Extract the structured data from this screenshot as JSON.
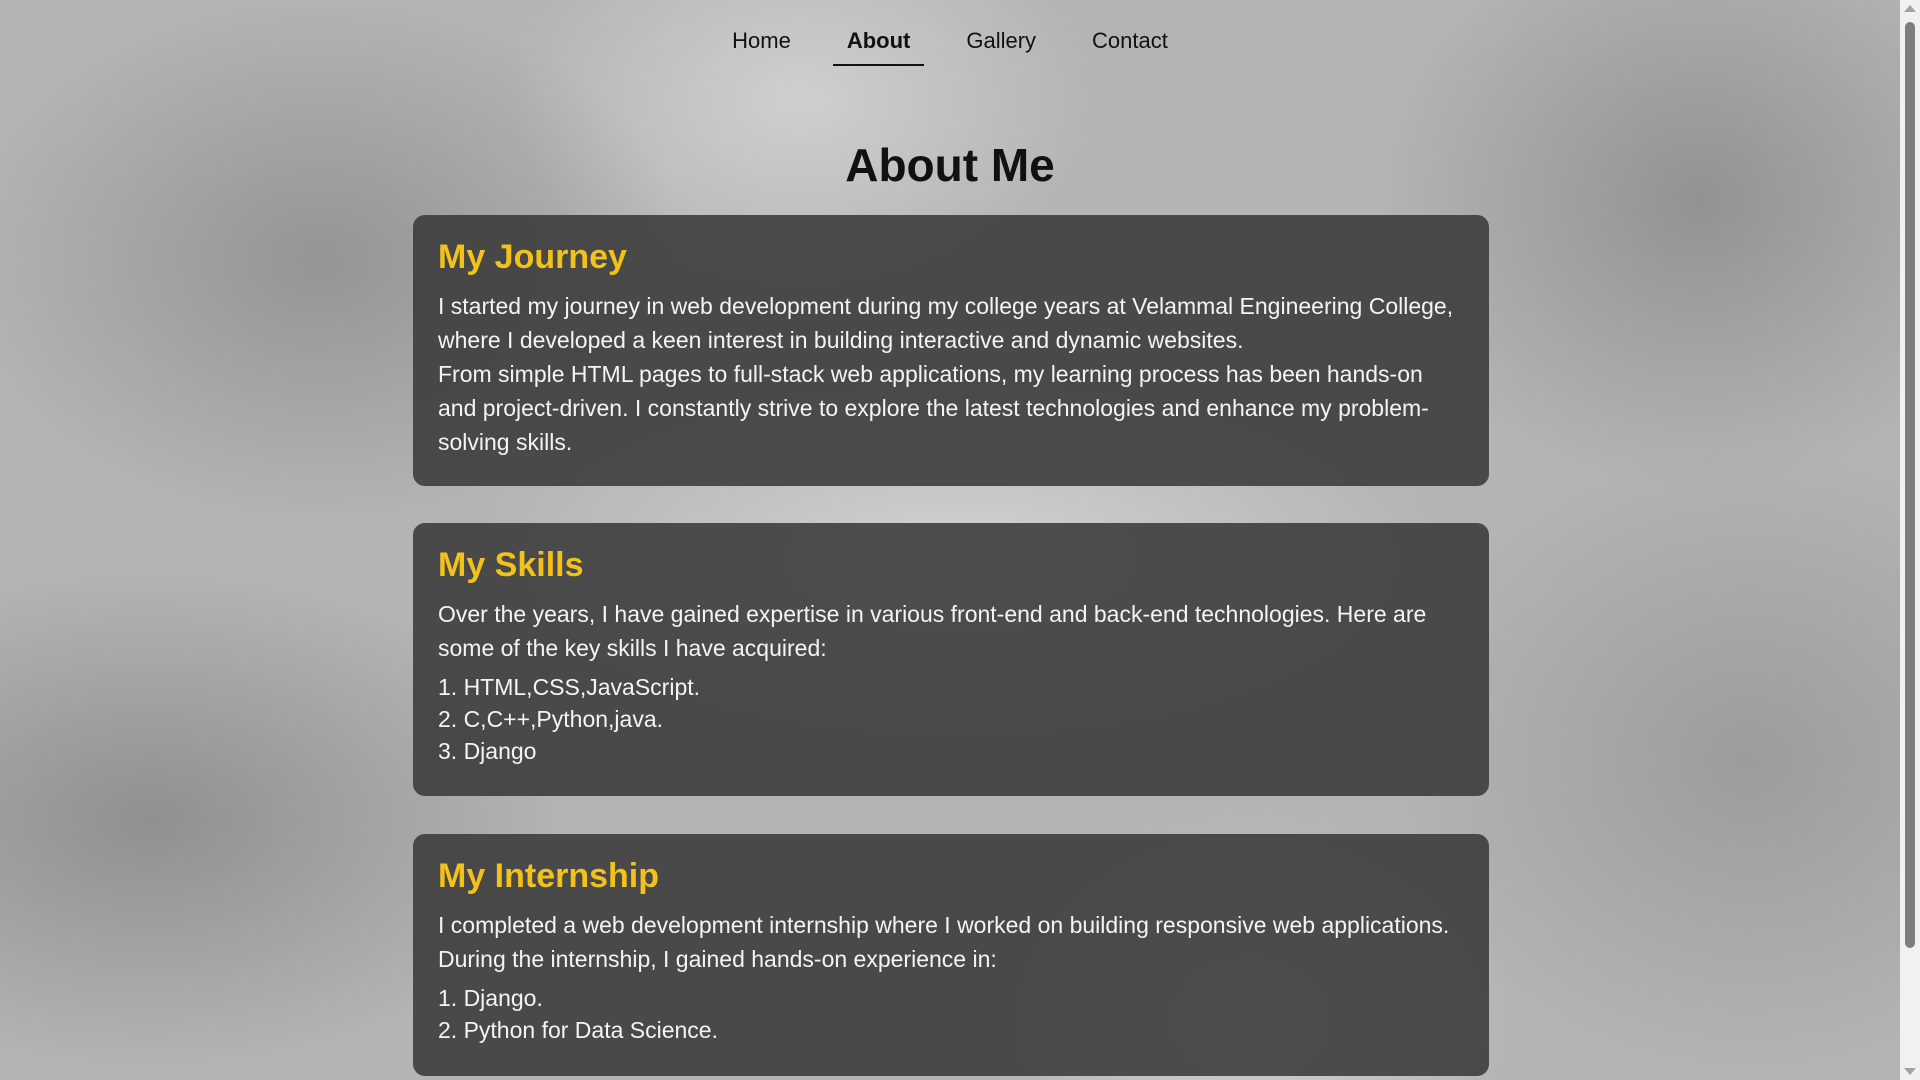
{
  "nav": {
    "items": [
      {
        "label": "Home",
        "active": false
      },
      {
        "label": "About",
        "active": true
      },
      {
        "label": "Gallery",
        "active": false
      },
      {
        "label": "Contact",
        "active": false
      }
    ]
  },
  "page_title": "About Me",
  "sections": {
    "journey": {
      "heading": "My Journey",
      "paragraphs": [
        "I started my journey in web development during my college years at Velammal Engineering College, where I developed a keen interest in building interactive and dynamic websites.",
        "From simple HTML pages to full-stack web applications, my learning process has been hands-on and project-driven. I constantly strive to explore the latest technologies and enhance my problem-solving skills."
      ]
    },
    "skills": {
      "heading": "My Skills",
      "intro": "Over the years, I have gained expertise in various front-end and back-end technologies. Here are some of the key skills I have acquired:",
      "items": [
        "1. HTML,CSS,JavaScript.",
        "2. C,C++,Python,java.",
        "3. Django"
      ]
    },
    "internship": {
      "heading": "My Internship",
      "intro": "I completed a web development internship where I worked on building responsive web applications. During the internship, I gained hands-on experience in:",
      "items": [
        "1. Django.",
        "2. Python for Data Science."
      ]
    }
  },
  "colors": {
    "accent": "#f2c21b",
    "card_bg": "#3a3a3a"
  }
}
